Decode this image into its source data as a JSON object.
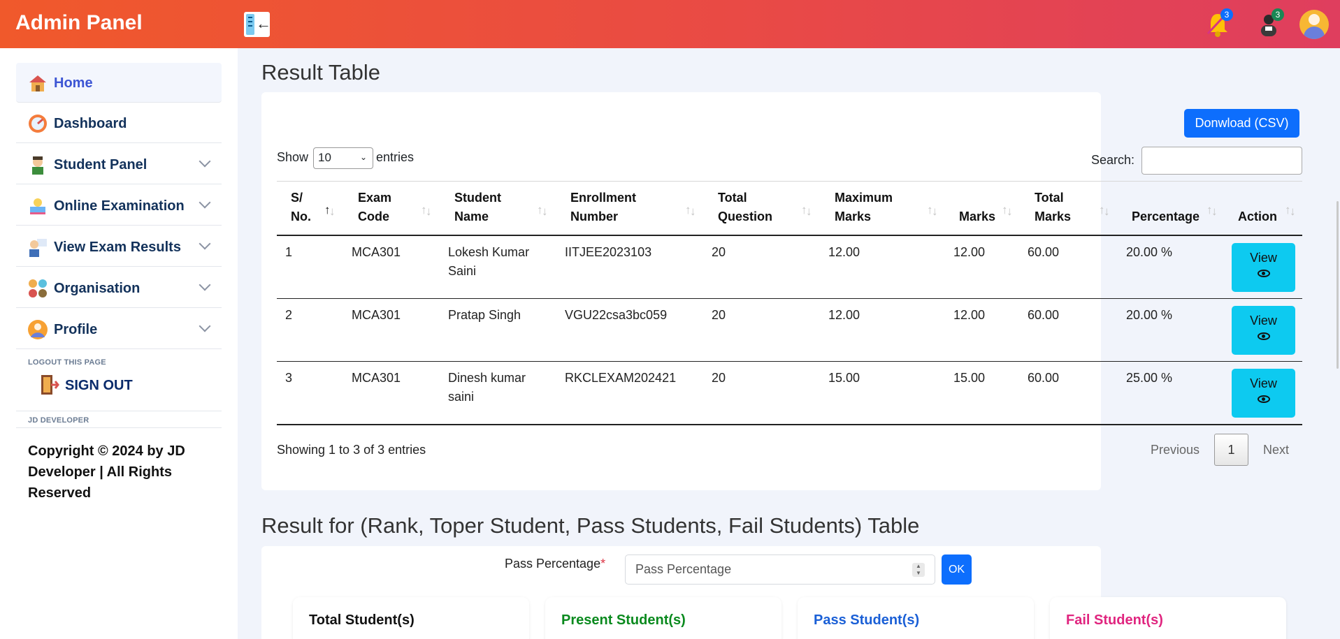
{
  "header": {
    "brand": "Admin Panel",
    "notifications_count": "3",
    "messages_count": "3",
    "colors": {
      "gradient_start": "#f0592b",
      "gradient_end": "#df3e5e",
      "badge_blue": "#0d6efd",
      "badge_green": "#198754"
    }
  },
  "sidebar": {
    "items": [
      {
        "label": "Home",
        "icon": "home-icon",
        "active": true
      },
      {
        "label": "Dashboard",
        "icon": "speedometer-icon"
      },
      {
        "label": "Student Panel",
        "icon": "student-icon",
        "expandable": true
      },
      {
        "label": "Online Examination",
        "icon": "exam-book-icon",
        "expandable": true
      },
      {
        "label": "View Exam Results",
        "icon": "teacher-icon",
        "expandable": true
      },
      {
        "label": "Organisation",
        "icon": "organisation-icon",
        "expandable": true
      },
      {
        "label": "Profile",
        "icon": "profile-icon",
        "expandable": true
      }
    ],
    "logout_caption": "LOGOUT THIS PAGE",
    "sign_out": "SIGN OUT",
    "developer_caption": "JD DEVELOPER",
    "copyright": "Copyright © 2024 by JD Developer | All Rights Reserved"
  },
  "result_table": {
    "title": "Result Table",
    "download_label": "Donwload (CSV)",
    "show_label": "Show",
    "entries_label": "entries",
    "page_size": "10",
    "search_label": "Search:",
    "columns": [
      {
        "line1": "S/",
        "line2": "No."
      },
      {
        "line1": "Exam",
        "line2": "Code"
      },
      {
        "line1": "Student",
        "line2": "Name"
      },
      {
        "line1": "Enrollment",
        "line2": "Number"
      },
      {
        "line1": "Total",
        "line2": "Question"
      },
      {
        "line1": "Maximum",
        "line2": "Marks"
      },
      {
        "line1": "",
        "line2": "Marks"
      },
      {
        "line1": "Total",
        "line2": "Marks"
      },
      {
        "line1": "",
        "line2": "Percentage"
      },
      {
        "line1": "",
        "line2": "Action"
      }
    ],
    "rows": [
      {
        "sno": "1",
        "exam_code": "MCA301",
        "name_l1": "Lokesh Kumar",
        "name_l2": "Saini",
        "enrollment": "IITJEE2023103",
        "total_question": "20",
        "maximum_marks": "12.00",
        "marks": "12.00",
        "total_marks": "60.00",
        "percentage": "20.00 %",
        "action": "View"
      },
      {
        "sno": "2",
        "exam_code": "MCA301",
        "name_l1": "Pratap Singh",
        "name_l2": "",
        "enrollment": "VGU22csa3bc059",
        "total_question": "20",
        "maximum_marks": "12.00",
        "marks": "12.00",
        "total_marks": "60.00",
        "percentage": "20.00 %",
        "action": "View"
      },
      {
        "sno": "3",
        "exam_code": "MCA301",
        "name_l1": "Dinesh kumar",
        "name_l2": "saini",
        "enrollment": "RKCLEXAM202421",
        "total_question": "20",
        "maximum_marks": "15.00",
        "marks": "15.00",
        "total_marks": "60.00",
        "percentage": "25.00 %",
        "action": "View"
      }
    ],
    "info": "Showing 1 to 3 of 3 entries",
    "pagination": {
      "previous": "Previous",
      "current": "1",
      "next": "Next"
    }
  },
  "rank_section": {
    "title": "Result for (Rank, Toper Student, Pass Students, Fail Students) Table",
    "pass_label": "Pass Percentage",
    "required_mark": "*",
    "pass_placeholder": "Pass Percentage",
    "ok_label": "OK",
    "cards": [
      {
        "label": "Total Student(s)",
        "color": "#111111"
      },
      {
        "label": "Present Student(s)",
        "color": "#0a8a1e"
      },
      {
        "label": "Pass Student(s)",
        "color": "#1a5fd6"
      },
      {
        "label": "Fail Student(s)",
        "color": "#e0257f"
      }
    ]
  }
}
